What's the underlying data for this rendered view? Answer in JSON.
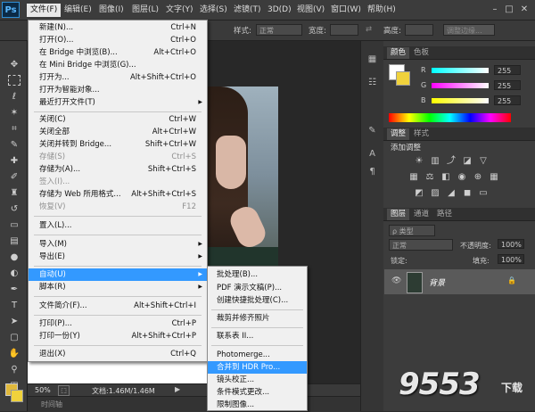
{
  "app": {
    "logo": "Ps"
  },
  "menubar": {
    "items": [
      "文件(F)",
      "编辑(E)",
      "图像(I)",
      "图层(L)",
      "文字(Y)",
      "选择(S)",
      "滤镜(T)",
      "3D(D)",
      "视图(V)",
      "窗口(W)",
      "帮助(H)"
    ],
    "active_index": 0,
    "window_buttons": [
      "–",
      "□",
      "✕"
    ]
  },
  "options_bar": {
    "style_label": "样式:",
    "style_value": "正常",
    "width_label": "宽度:",
    "height_label": "高度:",
    "refine_button": "调整边缘..."
  },
  "file_menu": {
    "items": [
      {
        "label": "新建(N)...",
        "shortcut": "Ctrl+N"
      },
      {
        "label": "打开(O)...",
        "shortcut": "Ctrl+O"
      },
      {
        "label": "在 Bridge 中浏览(B)...",
        "shortcut": "Alt+Ctrl+O"
      },
      {
        "label": "在 Mini Bridge 中浏览(G)...",
        "shortcut": ""
      },
      {
        "label": "打开为...",
        "shortcut": "Alt+Shift+Ctrl+O"
      },
      {
        "label": "打开为智能对象...",
        "shortcut": ""
      },
      {
        "label": "最近打开文件(T)",
        "shortcut": "",
        "submenu": true
      },
      {
        "label": "关闭(C)",
        "shortcut": "Ctrl+W"
      },
      {
        "label": "关闭全部",
        "shortcut": "Alt+Ctrl+W"
      },
      {
        "label": "关闭并转到 Bridge...",
        "shortcut": "Shift+Ctrl+W"
      },
      {
        "label": "存储(S)",
        "shortcut": "Ctrl+S",
        "disabled": true
      },
      {
        "label": "存储为(A)...",
        "shortcut": "Shift+Ctrl+S"
      },
      {
        "label": "签入(I)...",
        "shortcut": "",
        "disabled": true
      },
      {
        "label": "存储为 Web 所用格式...",
        "shortcut": "Alt+Shift+Ctrl+S"
      },
      {
        "label": "恢复(V)",
        "shortcut": "F12",
        "disabled": true
      },
      {
        "label": "置入(L)...",
        "shortcut": ""
      },
      {
        "label": "导入(M)",
        "shortcut": "",
        "submenu": true
      },
      {
        "label": "导出(E)",
        "shortcut": "",
        "submenu": true
      },
      {
        "label": "自动(U)",
        "shortcut": "",
        "submenu": true,
        "highlighted": true
      },
      {
        "label": "脚本(R)",
        "shortcut": "",
        "submenu": true
      },
      {
        "label": "文件简介(F)...",
        "shortcut": "Alt+Shift+Ctrl+I"
      },
      {
        "label": "打印(P)...",
        "shortcut": "Ctrl+P"
      },
      {
        "label": "打印一份(Y)",
        "shortcut": "Alt+Shift+Ctrl+P"
      },
      {
        "label": "退出(X)",
        "shortcut": "Ctrl+Q"
      }
    ]
  },
  "auto_submenu": {
    "items": [
      {
        "label": "批处理(B)..."
      },
      {
        "label": "PDF 演示文稿(P)..."
      },
      {
        "label": "创建快捷批处理(C)..."
      },
      {
        "label": "裁剪并修齐照片"
      },
      {
        "label": "联系表 II..."
      },
      {
        "label": "Photomerge..."
      },
      {
        "label": "合并到 HDR Pro...",
        "highlighted": true
      },
      {
        "label": "镜头校正..."
      },
      {
        "label": "条件模式更改..."
      },
      {
        "label": "限制图像..."
      }
    ]
  },
  "status": {
    "zoom": "50%",
    "doc_info": "文档:1.46M/1.46M",
    "timeline": "时间轴"
  },
  "color_panel": {
    "tabs": [
      "颜色",
      "色板"
    ],
    "channels": [
      {
        "name": "R",
        "value": "255"
      },
      {
        "name": "G",
        "value": "255"
      },
      {
        "name": "B",
        "value": "255"
      }
    ]
  },
  "adjust_panel": {
    "tabs": [
      "调整",
      "样式"
    ],
    "title": "添加调整"
  },
  "layers_panel": {
    "tabs": [
      "图层",
      "通道",
      "路径"
    ],
    "kind_label": "ρ 类型",
    "blend_mode": "正常",
    "opacity_label": "不透明度:",
    "opacity_value": "100%",
    "lock_label": "锁定:",
    "fill_label": "填充:",
    "fill_value": "100%",
    "layer_name": "背景"
  },
  "watermark": {
    "text": "9553",
    "sub": "下载"
  }
}
